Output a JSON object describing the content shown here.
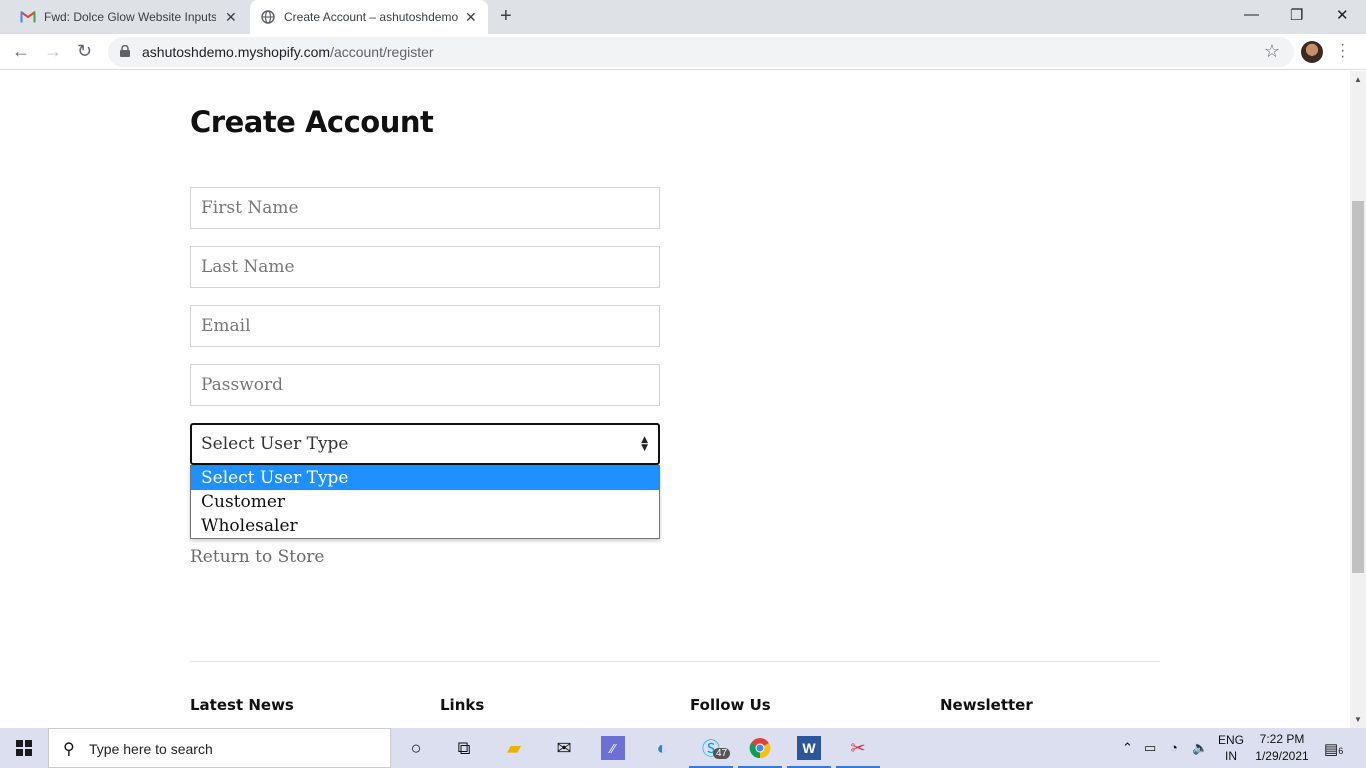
{
  "browser": {
    "tabs": [
      {
        "title": "Fwd: Dolce Glow Website Inputs",
        "close": "✕"
      },
      {
        "title": "Create Account – ashutoshdemo",
        "close": "✕"
      }
    ],
    "new_tab": "+",
    "window_controls": {
      "minimize": "—",
      "restore": "❐",
      "close": "✕"
    },
    "url_domain": "ashutoshdemo.myshopify.com",
    "url_path": "/account/register"
  },
  "page": {
    "title": "Create Account",
    "fields": {
      "first_name": "First Name",
      "last_name": "Last Name",
      "email": "Email",
      "password": "Password"
    },
    "user_type": {
      "selected": "Select User Type",
      "options": [
        "Select User Type",
        "Customer",
        "Wholesaler"
      ]
    },
    "return_link": "Return to Store",
    "footer": {
      "latest_news": "Latest News",
      "links": "Links",
      "follow_us": "Follow Us",
      "newsletter": "Newsletter"
    }
  },
  "taskbar": {
    "search_placeholder": "Type here to search",
    "skype_badge": "47",
    "lang_top": "ENG",
    "lang_bottom": "IN",
    "time": "7:22 PM",
    "date": "1/29/2021",
    "notifications": "6"
  },
  "colors": {
    "accent_blue": "#1e90ff",
    "tab_strip": "#dee1e6",
    "taskbar": "#dcdff0"
  }
}
